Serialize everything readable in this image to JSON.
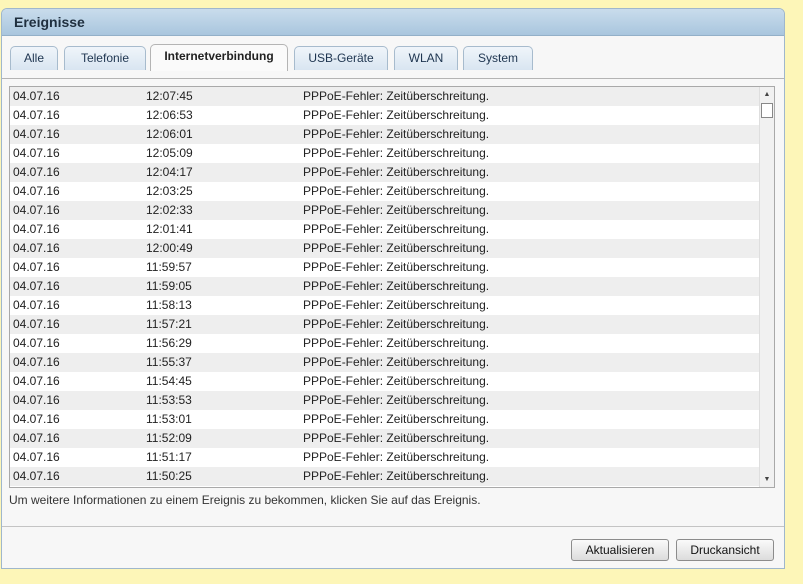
{
  "header": {
    "title": "Ereignisse"
  },
  "tabs": [
    {
      "label": "Alle",
      "active": false
    },
    {
      "label": "Telefonie",
      "active": false
    },
    {
      "label": "Internetverbindung",
      "active": true
    },
    {
      "label": "USB-Geräte",
      "active": false
    },
    {
      "label": "WLAN",
      "active": false
    },
    {
      "label": "System",
      "active": false
    }
  ],
  "events": [
    {
      "date": "04.07.16",
      "time": "12:07:45",
      "message": "PPPoE-Fehler: Zeitüberschreitung."
    },
    {
      "date": "04.07.16",
      "time": "12:06:53",
      "message": "PPPoE-Fehler: Zeitüberschreitung."
    },
    {
      "date": "04.07.16",
      "time": "12:06:01",
      "message": "PPPoE-Fehler: Zeitüberschreitung."
    },
    {
      "date": "04.07.16",
      "time": "12:05:09",
      "message": "PPPoE-Fehler: Zeitüberschreitung."
    },
    {
      "date": "04.07.16",
      "time": "12:04:17",
      "message": "PPPoE-Fehler: Zeitüberschreitung."
    },
    {
      "date": "04.07.16",
      "time": "12:03:25",
      "message": "PPPoE-Fehler: Zeitüberschreitung."
    },
    {
      "date": "04.07.16",
      "time": "12:02:33",
      "message": "PPPoE-Fehler: Zeitüberschreitung."
    },
    {
      "date": "04.07.16",
      "time": "12:01:41",
      "message": "PPPoE-Fehler: Zeitüberschreitung."
    },
    {
      "date": "04.07.16",
      "time": "12:00:49",
      "message": "PPPoE-Fehler: Zeitüberschreitung."
    },
    {
      "date": "04.07.16",
      "time": "11:59:57",
      "message": "PPPoE-Fehler: Zeitüberschreitung."
    },
    {
      "date": "04.07.16",
      "time": "11:59:05",
      "message": "PPPoE-Fehler: Zeitüberschreitung."
    },
    {
      "date": "04.07.16",
      "time": "11:58:13",
      "message": "PPPoE-Fehler: Zeitüberschreitung."
    },
    {
      "date": "04.07.16",
      "time": "11:57:21",
      "message": "PPPoE-Fehler: Zeitüberschreitung."
    },
    {
      "date": "04.07.16",
      "time": "11:56:29",
      "message": "PPPoE-Fehler: Zeitüberschreitung."
    },
    {
      "date": "04.07.16",
      "time": "11:55:37",
      "message": "PPPoE-Fehler: Zeitüberschreitung."
    },
    {
      "date": "04.07.16",
      "time": "11:54:45",
      "message": "PPPoE-Fehler: Zeitüberschreitung."
    },
    {
      "date": "04.07.16",
      "time": "11:53:53",
      "message": "PPPoE-Fehler: Zeitüberschreitung."
    },
    {
      "date": "04.07.16",
      "time": "11:53:01",
      "message": "PPPoE-Fehler: Zeitüberschreitung."
    },
    {
      "date": "04.07.16",
      "time": "11:52:09",
      "message": "PPPoE-Fehler: Zeitüberschreitung."
    },
    {
      "date": "04.07.16",
      "time": "11:51:17",
      "message": "PPPoE-Fehler: Zeitüberschreitung."
    },
    {
      "date": "04.07.16",
      "time": "11:50:25",
      "message": "PPPoE-Fehler: Zeitüberschreitung."
    }
  ],
  "hint": "Um weitere Informationen zu einem Ereignis zu bekommen, klicken Sie auf das Ereignis.",
  "buttons": {
    "refresh": "Aktualisieren",
    "print": "Druckansicht"
  },
  "icons": {
    "scroll_up": "scroll-up-arrow-icon",
    "scroll_down": "scroll-down-arrow-icon"
  },
  "colors": {
    "background": "#fdf6b8",
    "header": "#b8d0e6",
    "row_alt": "#eeeeee"
  }
}
